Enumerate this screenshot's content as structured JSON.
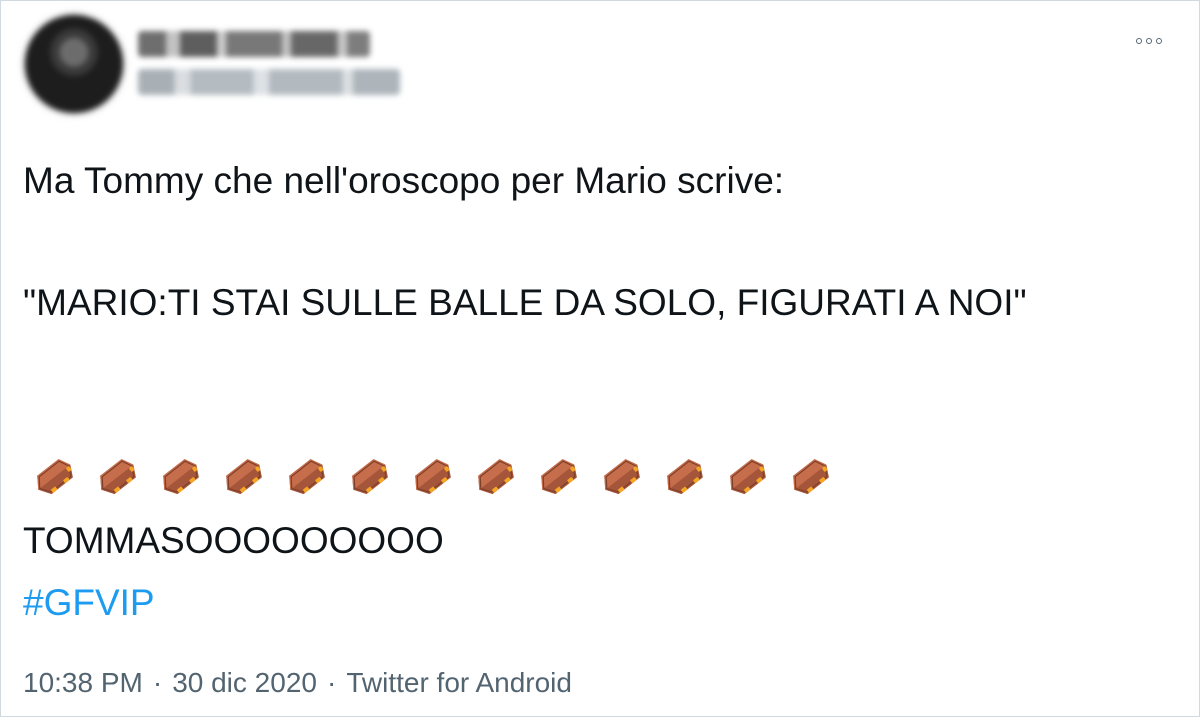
{
  "tweet": {
    "text_line1": "Ma Tommy che nell'oroscopo per Mario scrive:",
    "text_quote": "\"MARIO:TI STAI SULLE BALLE DA SOLO, FIGURATI A NOI\"",
    "emoji_name": "coffin",
    "emoji_count": 13,
    "text_shout": "TOMMASOOOOOOOOO",
    "hashtag": "#GFVIP",
    "time": "10:38 PM",
    "separator": "·",
    "date": "30 dic 2020",
    "source": "Twitter for Android"
  },
  "colors": {
    "link": "#1d9bf0",
    "meta": "#536471",
    "text": "#0f1419",
    "coffin_body": "#a5563a",
    "coffin_light": "#c66d4b",
    "coffin_handle": "#f5a623"
  },
  "icons": {
    "more": "more-horizontal-icon"
  }
}
